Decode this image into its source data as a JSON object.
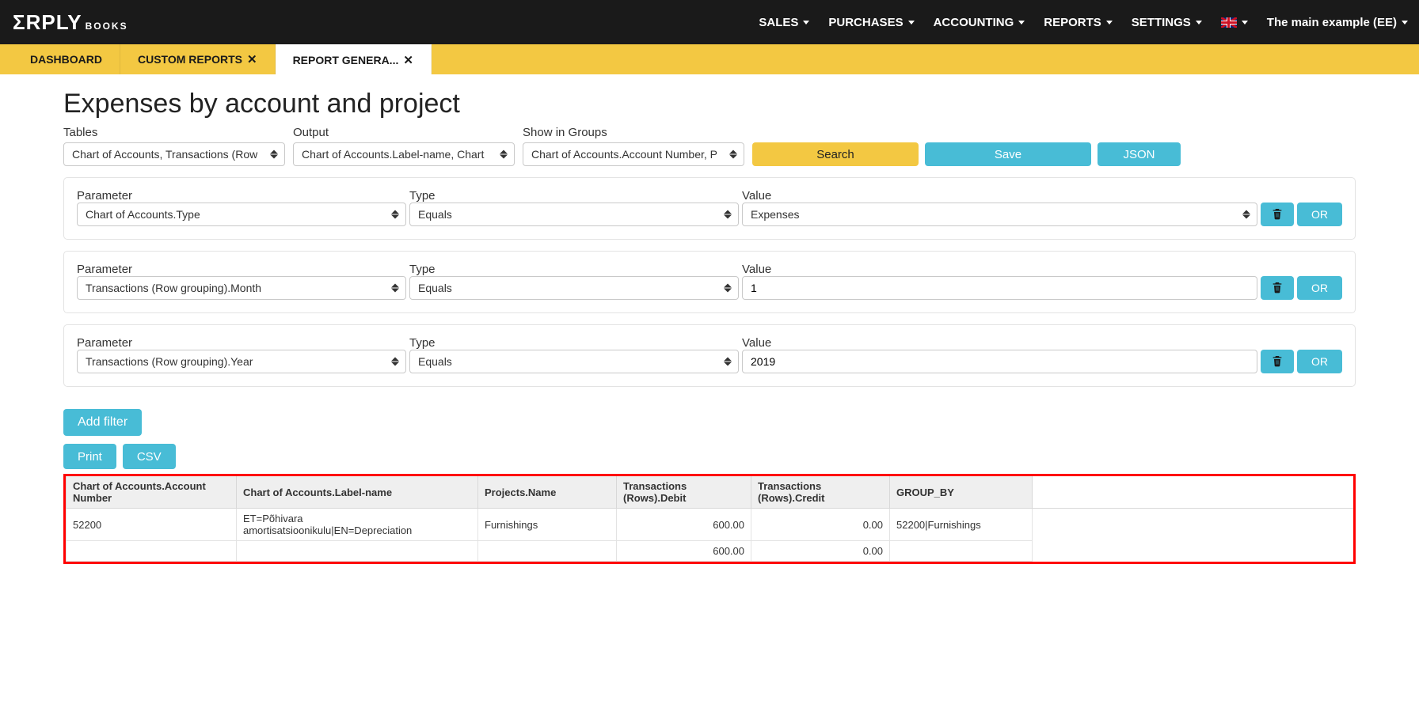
{
  "brand": {
    "main": "ΣRPLY",
    "sub": "BOOKS"
  },
  "topnav": {
    "sales": "SALES",
    "purchases": "PURCHASES",
    "accounting": "ACCOUNTING",
    "reports": "REPORTS",
    "settings": "SETTINGS",
    "company": "The main example (EE)"
  },
  "tabs": {
    "dashboard": "DASHBOARD",
    "custom": "CUSTOM REPORTS",
    "generator": "REPORT GENERA..."
  },
  "page_title": "Expenses by account and project",
  "builder": {
    "tables_label": "Tables",
    "tables_value": "Chart of Accounts, Transactions (Row",
    "output_label": "Output",
    "output_value": "Chart of Accounts.Label-name, Chart",
    "groups_label": "Show in Groups",
    "groups_value": "Chart of Accounts.Account Number, P",
    "search_btn": "Search",
    "save_btn": "Save",
    "json_btn": "JSON"
  },
  "param_labels": {
    "parameter": "Parameter",
    "type": "Type",
    "value": "Value",
    "or": "OR"
  },
  "filters": [
    {
      "parameter": "Chart of Accounts.Type",
      "type": "Equals",
      "value": "Expenses",
      "value_is_select": true
    },
    {
      "parameter": "Transactions (Row grouping).Month",
      "type": "Equals",
      "value": "1",
      "value_is_select": false
    },
    {
      "parameter": "Transactions (Row grouping).Year",
      "type": "Equals",
      "value": "2019",
      "value_is_select": false
    }
  ],
  "actions": {
    "add_filter": "Add filter",
    "print": "Print",
    "csv": "CSV"
  },
  "results": {
    "headers": {
      "acct_no": "Chart of Accounts.Account Number",
      "label": "Chart of Accounts.Label-name",
      "project": "Projects.Name",
      "debit": "Transactions (Rows).Debit",
      "credit": "Transactions (Rows).Credit",
      "group_by": "GROUP_BY"
    },
    "rows": [
      {
        "acct_no": "52200",
        "label": "ET=Põhivara amortisatsioonikulu|EN=Depreciation",
        "project": "Furnishings",
        "debit": "600.00",
        "credit": "0.00",
        "group_by": "52200|Furnishings"
      }
    ],
    "totals": {
      "debit": "600.00",
      "credit": "0.00"
    }
  }
}
